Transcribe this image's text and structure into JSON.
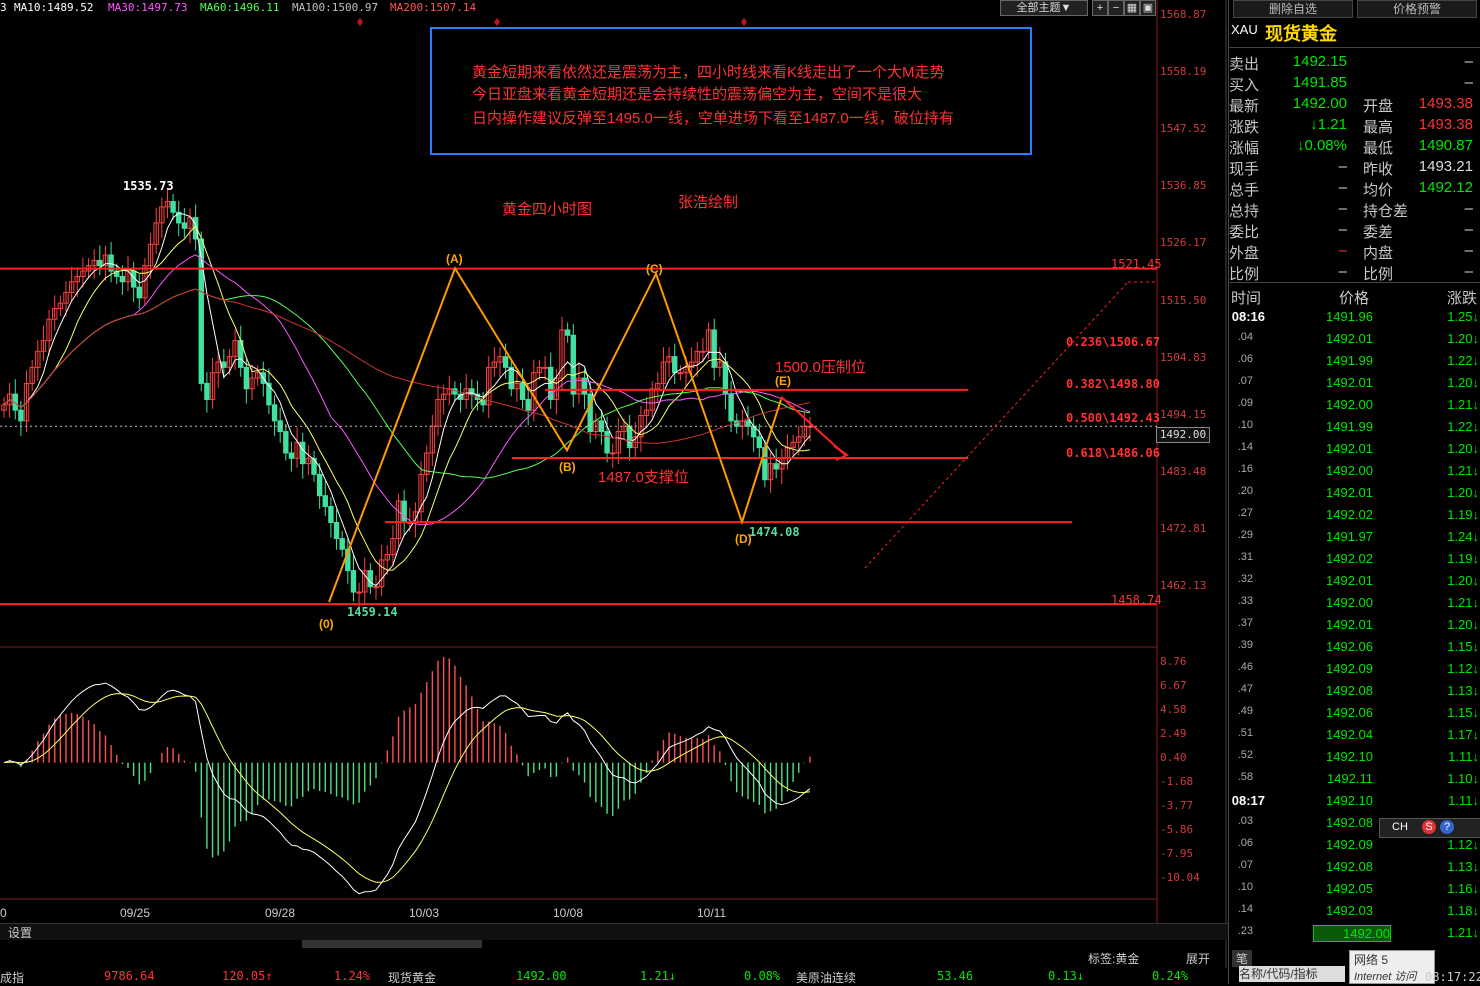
{
  "top_indicators": {
    "prefix": "3",
    "ma10": "MA10:1489.52",
    "ma30": "MA30:1497.73",
    "ma60": "MA60:1496.11",
    "ma100": "MA100:1500.97",
    "ma200": "MA200:1507.14",
    "theme_label": "全部主题▼"
  },
  "annotation_box": {
    "line1": "黄金短期来看依然还是震荡为主，四小时线来看K线走出了一个大M走势",
    "line2": "今日亚盘来看黄金短期还是会持续性的震荡偏空为主，空间不是很大",
    "line3": "日内操作建议反弹至1495.0一线，空单进场下看至1487.0一线，破位持有"
  },
  "chart_title": "黄金四小时图",
  "author": "张浩绘制",
  "labels": {
    "resistance": "1500.0压制位",
    "support": "1487.0支撑位",
    "wave_0": "(0)",
    "wave_a": "(A)",
    "wave_b": "(B)",
    "wave_c": "(C)",
    "wave_d": "(D)",
    "wave_e": "(E)",
    "high_label": "1535.73",
    "low_label": "1459.14",
    "d_label": "1474.08",
    "fib_236": "0.236\\1506.67",
    "fib_382": "0.382\\1498.80",
    "fib_500": "0.500\\1492.43",
    "fib_618": "0.618\\1486.06",
    "line_1521": "1521.45",
    "line_1458": "1458.74",
    "current_price": "1492.00",
    "settings": "设置",
    "tag": "标签:黄金",
    "expand": "展开",
    "pen": "笔"
  },
  "chart_data": {
    "type": "candlestick",
    "title": "",
    "y_ticks": [
      "1568.87",
      "1558.19",
      "1547.52",
      "1536.85",
      "1526.17",
      "1515.50",
      "1504.83",
      "1494.15",
      "1483.48",
      "1472.81",
      "1462.13"
    ],
    "ylim": [
      1455.0,
      1570.5
    ],
    "x_ticks": [
      "0",
      "09/25",
      "09/28",
      "10/03",
      "10/08",
      "10/11"
    ],
    "macd_ticks": [
      "8.76",
      "6.67",
      "4.58",
      "2.49",
      "0.40",
      "-1.68",
      "-3.77",
      "-5.86",
      "-7.95",
      "-10.04"
    ],
    "macd_lim": [
      -11.5,
      9.5
    ],
    "ohlc_close": [
      1496,
      1498,
      1495,
      1493,
      1500,
      1503,
      1506,
      1508,
      1512,
      1514,
      1515,
      1517,
      1519,
      1520,
      1521,
      1522,
      1523,
      1522,
      1524,
      1521,
      1520,
      1519,
      1521,
      1518,
      1516,
      1522,
      1526,
      1530,
      1533,
      1534,
      1532,
      1530,
      1529,
      1531,
      1527,
      1500,
      1497,
      1502,
      1504,
      1503,
      1505,
      1508,
      1503,
      1499,
      1501,
      1502,
      1500,
      1496,
      1493,
      1491,
      1487,
      1486,
      1489,
      1485,
      1486,
      1483,
      1479,
      1477,
      1474,
      1471,
      1469,
      1465,
      1461,
      1461,
      1465,
      1462,
      1462,
      1467,
      1468,
      1471,
      1478,
      1474,
      1474,
      1476,
      1483,
      1487,
      1492,
      1497,
      1498,
      1499,
      1498,
      1497,
      1499,
      1498,
      1497,
      1496,
      1503,
      1504,
      1505,
      1503,
      1499,
      1500,
      1497,
      1495,
      1502,
      1503,
      1503,
      1497,
      1501,
      1510,
      1509,
      1498,
      1501,
      1498,
      1491,
      1493,
      1491,
      1487,
      1487,
      1491,
      1492,
      1488,
      1490,
      1494,
      1495,
      1499,
      1500,
      1504,
      1505,
      1502,
      1502,
      1503,
      1504,
      1506,
      1506,
      1510,
      1503,
      1504,
      1498,
      1493,
      1492,
      1493,
      1492,
      1490,
      1488,
      1482,
      1485,
      1484,
      1486,
      1488,
      1489,
      1490,
      1492,
      1492
    ],
    "resistance_line": 1521.45,
    "support_line": 1458.74,
    "pattern_points": [
      {
        "label": "(0)",
        "price": 1459.14
      },
      {
        "label": "(A)",
        "price": 1521.5
      },
      {
        "label": "(B)",
        "price": 1487.5
      },
      {
        "label": "(C)",
        "price": 1520.5
      },
      {
        "label": "(D)",
        "price": 1474.08
      },
      {
        "label": "(E)",
        "price": 1497.0
      }
    ],
    "fib_levels": [
      {
        "ratio": "0.236",
        "price": 1506.67
      },
      {
        "ratio": "0.382",
        "price": 1498.8
      },
      {
        "ratio": "0.500",
        "price": 1492.43
      },
      {
        "ratio": "0.618",
        "price": 1486.06
      }
    ],
    "current_price": 1492.0
  },
  "right_panel": {
    "btn_delete": "删除自选",
    "btn_alert": "价格预警",
    "symbol": "XAU",
    "name": "现货黄金",
    "rows": [
      {
        "l1": "卖出",
        "v1": "1492.15",
        "c1": "grn",
        "l2": "",
        "v2": "–",
        "c2": "wht"
      },
      {
        "l1": "买入",
        "v1": "1491.85",
        "c1": "grn",
        "l2": "",
        "v2": "–",
        "c2": "wht"
      },
      {
        "l1": "最新",
        "v1": "1492.00",
        "c1": "grn",
        "l2": "开盘",
        "v2": "1493.38",
        "c2": "red"
      },
      {
        "l1": "涨跌",
        "v1": "↓1.21",
        "c1": "grn",
        "l2": "最高",
        "v2": "1493.38",
        "c2": "red"
      },
      {
        "l1": "涨幅",
        "v1": "↓0.08%",
        "c1": "grn",
        "l2": "最低",
        "v2": "1490.87",
        "c2": "grn"
      },
      {
        "l1": "现手",
        "v1": "–",
        "c1": "wht",
        "l2": "昨收",
        "v2": "1493.21",
        "c2": "wht"
      },
      {
        "l1": "总手",
        "v1": "–",
        "c1": "wht",
        "l2": "均价",
        "v2": "1492.12",
        "c2": "grn"
      },
      {
        "l1": "总持",
        "v1": "–",
        "c1": "wht",
        "l2": "持仓差",
        "v2": "–",
        "c2": "wht"
      },
      {
        "l1": "委比",
        "v1": "–",
        "c1": "wht",
        "l2": "委差",
        "v2": "–",
        "c2": "wht"
      },
      {
        "l1": "外盘",
        "v1": "–",
        "c1": "red",
        "l2": "内盘",
        "v2": "–",
        "c2": "wht"
      },
      {
        "l1": "比例",
        "v1": "–",
        "c1": "wht",
        "l2": "比例",
        "v2": "–",
        "c2": "wht"
      }
    ],
    "tick_header": {
      "time": "时间",
      "price": "价格",
      "change": "涨跌"
    },
    "ticks": [
      {
        "t": "08:16",
        "p": "1491.96",
        "c": "1.25↓"
      },
      {
        "t": ".04",
        "p": "1492.01",
        "c": "1.20↓"
      },
      {
        "t": ".06",
        "p": "1491.99",
        "c": "1.22↓"
      },
      {
        "t": ".07",
        "p": "1492.01",
        "c": "1.20↓"
      },
      {
        "t": ".09",
        "p": "1492.00",
        "c": "1.21↓"
      },
      {
        "t": ".10",
        "p": "1491.99",
        "c": "1.22↓"
      },
      {
        "t": ".14",
        "p": "1492.01",
        "c": "1.20↓"
      },
      {
        "t": ".16",
        "p": "1492.00",
        "c": "1.21↓"
      },
      {
        "t": ".20",
        "p": "1492.01",
        "c": "1.20↓"
      },
      {
        "t": ".27",
        "p": "1492.02",
        "c": "1.19↓"
      },
      {
        "t": ".29",
        "p": "1491.97",
        "c": "1.24↓"
      },
      {
        "t": ".31",
        "p": "1492.02",
        "c": "1.19↓"
      },
      {
        "t": ".32",
        "p": "1492.01",
        "c": "1.20↓"
      },
      {
        "t": ".33",
        "p": "1492.00",
        "c": "1.21↓"
      },
      {
        "t": ".37",
        "p": "1492.01",
        "c": "1.20↓"
      },
      {
        "t": ".39",
        "p": "1492.06",
        "c": "1.15↓"
      },
      {
        "t": ".46",
        "p": "1492.09",
        "c": "1.12↓"
      },
      {
        "t": ".47",
        "p": "1492.08",
        "c": "1.13↓"
      },
      {
        "t": ".49",
        "p": "1492.06",
        "c": "1.15↓"
      },
      {
        "t": ".51",
        "p": "1492.04",
        "c": "1.17↓"
      },
      {
        "t": ".52",
        "p": "1492.10",
        "c": "1.11↓"
      },
      {
        "t": ".58",
        "p": "1492.11",
        "c": "1.10↓"
      },
      {
        "t": "08:17",
        "p": "1492.10",
        "c": "1.11↓"
      },
      {
        "t": ".03",
        "p": "1492.08",
        "c": "1.13↓"
      },
      {
        "t": ".06",
        "p": "1492.09",
        "c": "1.12↓"
      },
      {
        "t": ".07",
        "p": "1492.08",
        "c": "1.13↓"
      },
      {
        "t": ".10",
        "p": "1492.05",
        "c": "1.16↓"
      },
      {
        "t": ".14",
        "p": "1492.03",
        "c": "1.18↓"
      },
      {
        "t": ".23",
        "p": "1492.00",
        "c": "1.21↓"
      }
    ],
    "net_label": "网络 5",
    "search_hint": "名称/代码/指标",
    "ie_label": "Internet 访问",
    "clock": "08:17:22",
    "ime": "CH"
  },
  "bottom_ticker": {
    "i1_name": "成指",
    "i1_val": "9786.64",
    "i1_chg": "120.05↑",
    "i1_pct": "1.24%",
    "i2_name": "现货黄金",
    "i2_val": "1492.00",
    "i2_chg": "1.21↓",
    "i2_pct": "0.08%",
    "i3_name": "美原油连续",
    "i3_val": "53.46",
    "i3_chg": "0.13↓",
    "i3_pct": "0.24%"
  }
}
